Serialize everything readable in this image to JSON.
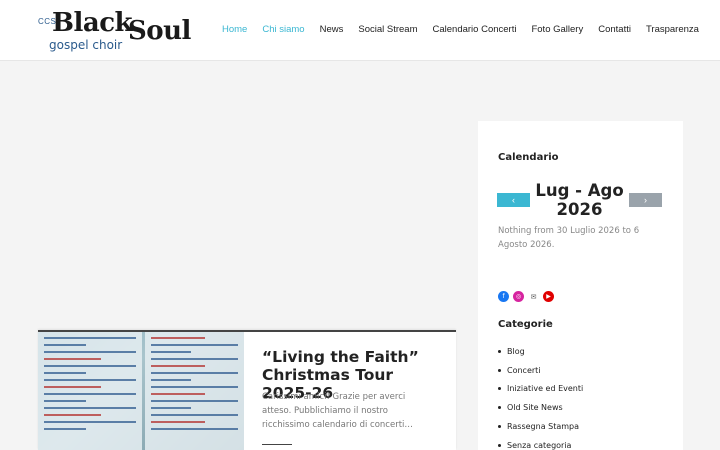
{
  "logo": {
    "ccs": "CCS",
    "black": "Black",
    "soul": "Soul",
    "sub": "gospel choir"
  },
  "nav": {
    "items": [
      {
        "label": "Home",
        "active": true
      },
      {
        "label": "Chi siamo",
        "active": true
      },
      {
        "label": "News",
        "active": false
      },
      {
        "label": "Social Stream",
        "active": false
      },
      {
        "label": "Calendario Concerti",
        "active": false
      },
      {
        "label": "Foto Gallery",
        "active": false
      },
      {
        "label": "Contatti",
        "active": false
      },
      {
        "label": "Trasparenza",
        "active": false
      }
    ]
  },
  "post": {
    "title": "“Living the Faith” Christmas Tour 2025-26",
    "excerpt": "Carissimi amici! Grazie per averci atteso. Pubblichiamo il nostro ricchissimo calendario di concerti…",
    "image_icon": "concert-poster-image"
  },
  "sidebar": {
    "calendar_title": "Calendario",
    "month_label": "Lug - Ago 2026",
    "prev_icon": "chevron-left-icon",
    "next_icon": "chevron-right-icon",
    "empty_message": "Nothing from 30 Luglio 2026 to 6 Agosto 2026.",
    "socials": [
      {
        "name": "facebook-icon",
        "glyph": "f"
      },
      {
        "name": "instagram-icon",
        "glyph": "◎"
      },
      {
        "name": "mail-icon",
        "glyph": "✉"
      },
      {
        "name": "youtube-icon",
        "glyph": "▶"
      }
    ],
    "categories_title": "Categorie",
    "categories": [
      "Blog",
      "Concerti",
      "Iniziative ed Eventi",
      "Old Site News",
      "Rassegna Stampa",
      "Senza categoria"
    ]
  },
  "colors": {
    "accent": "#3bb7d2",
    "nav_disabled_button": "#9aa3ab",
    "background": "#f4f4f4"
  }
}
